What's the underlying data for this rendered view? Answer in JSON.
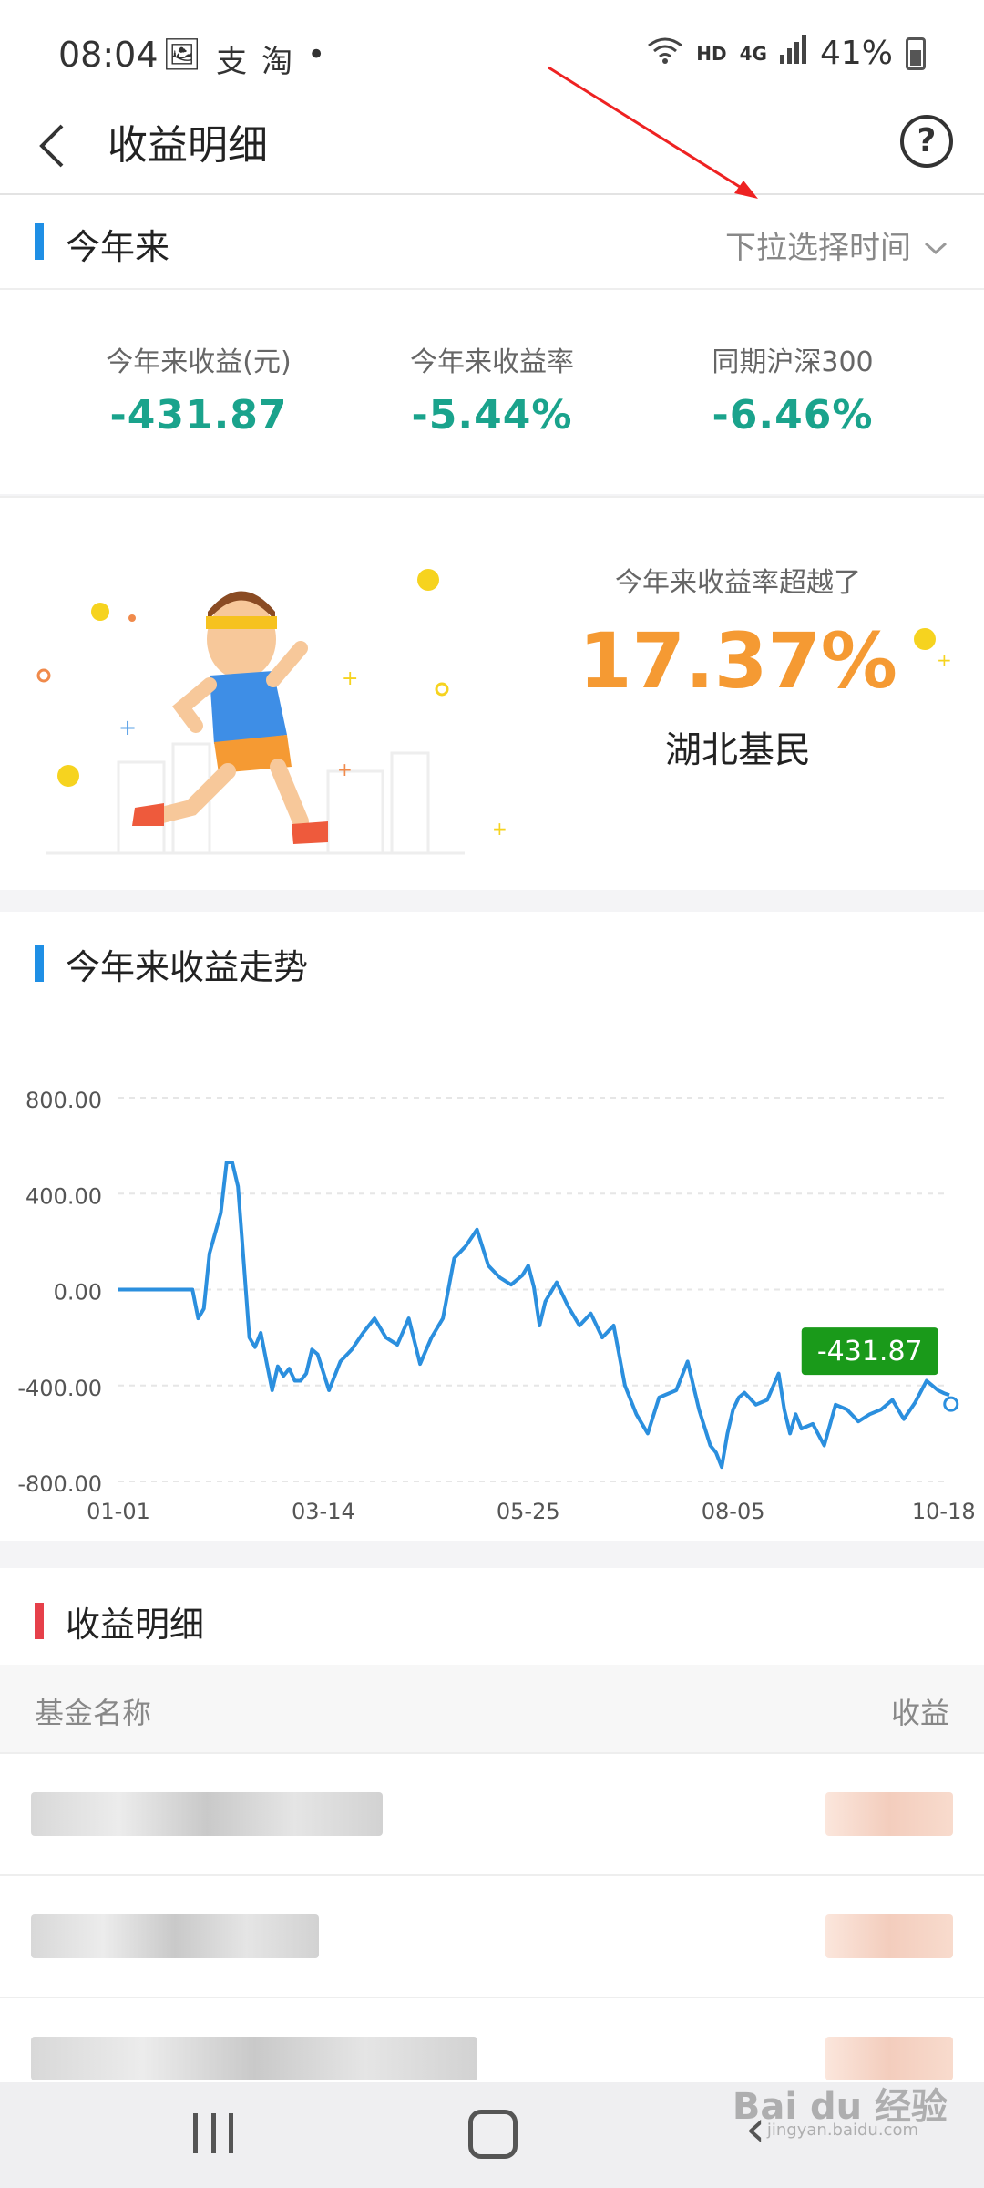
{
  "status_bar": {
    "time": "08:04",
    "left_icons": [
      "gallery-icon",
      "alipay-icon",
      "taobao-icon"
    ],
    "network": "HD",
    "network_gen": "4G",
    "battery": "41%"
  },
  "header": {
    "title": "收益明细",
    "help_symbol": "?"
  },
  "range_section": {
    "title": "今年来",
    "selector_label": "下拉选择时间"
  },
  "stats": [
    {
      "label": "今年来收益(元)",
      "value": "-431.87"
    },
    {
      "label": "今年来收益率",
      "value": "-5.44%"
    },
    {
      "label": "同期沪深300",
      "value": "-6.46%"
    }
  ],
  "ranking": {
    "description": "今年来收益率超越了",
    "percent": "17.37%",
    "group": "湖北基民"
  },
  "trend_section": {
    "title": "今年来收益走势",
    "current_label": "-431.87"
  },
  "chart_data": {
    "type": "line",
    "ylim": [
      -800,
      800
    ],
    "ytick_labels": [
      "800.00",
      "400.00",
      "0.00",
      "-400.00",
      "-800.00"
    ],
    "ytick_values": [
      800,
      400,
      0,
      -400,
      -800
    ],
    "xtick_labels": [
      "01-01",
      "03-14",
      "05-25",
      "08-05",
      "10-18"
    ],
    "xtick_values": [
      0,
      72,
      144,
      216,
      290
    ],
    "series": [
      {
        "color": "#2b8fde",
        "x": [
          0,
          16,
          26,
          28,
          30,
          32,
          36,
          38,
          40,
          42,
          44,
          46,
          48,
          50,
          52,
          54,
          56,
          58,
          60,
          62,
          64,
          66,
          68,
          70,
          74,
          78,
          82,
          86,
          90,
          94,
          98,
          102,
          106,
          110,
          114,
          118,
          122,
          126,
          130,
          134,
          138,
          142,
          144,
          146,
          148,
          150,
          154,
          158,
          162,
          166,
          170,
          174,
          178,
          182,
          186,
          190,
          196,
          200,
          204,
          208,
          210,
          212,
          214,
          216,
          218,
          220,
          224,
          228,
          232,
          234,
          236,
          238,
          240,
          244,
          248,
          252,
          256,
          260,
          264,
          268,
          272,
          276,
          280,
          284,
          288,
          290,
          292
        ],
        "y": [
          0,
          0,
          0,
          -120,
          -80,
          150,
          320,
          530,
          530,
          430,
          120,
          -200,
          -240,
          -180,
          -300,
          -420,
          -320,
          -360,
          -330,
          -380,
          -380,
          -350,
          -250,
          -270,
          -420,
          -300,
          -250,
          -180,
          -120,
          -200,
          -230,
          -120,
          -310,
          -200,
          -120,
          130,
          180,
          250,
          100,
          50,
          20,
          60,
          100,
          10,
          -150,
          -50,
          30,
          -70,
          -150,
          -100,
          -200,
          -150,
          -400,
          -520,
          -600,
          -450,
          -420,
          -300,
          -500,
          -650,
          -680,
          -740,
          -600,
          -500,
          -450,
          -430,
          -480,
          -460,
          -350,
          -500,
          -600,
          -520,
          -580,
          -560,
          -650,
          -480,
          -500,
          -550,
          -520,
          -500,
          -460,
          -540,
          -470,
          -380,
          -420,
          -431.87,
          -440
        ]
      }
    ],
    "title": "今年来收益走势",
    "grid": true
  },
  "detail_section": {
    "title": "收益明细",
    "col_name": "基金名称",
    "col_value": "收益"
  },
  "watermark": {
    "brand": "Bai du 经验",
    "sub": "jingyan.baidu.com"
  },
  "colors": {
    "accent_blue": "#1f8fe5",
    "negative_green": "#1aa38c",
    "rank_orange": "#f59a33",
    "label_green": "#1a9a1a",
    "section_red": "#e6404a"
  }
}
